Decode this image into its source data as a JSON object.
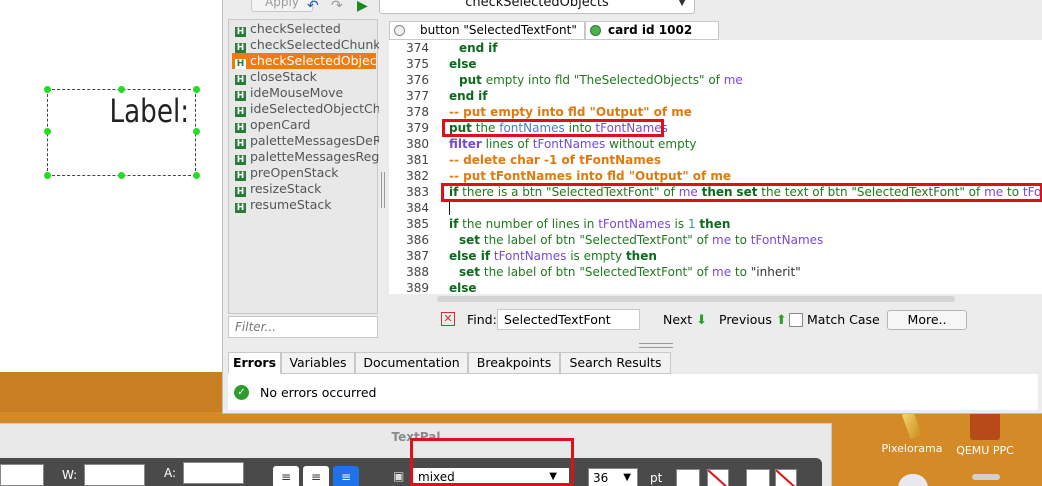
{
  "card": {
    "label_text": "Label:"
  },
  "editor": {
    "toolbar": {
      "apply_label": "Apply",
      "current_handler": "checkSelectedObjects"
    },
    "handlers": [
      "checkSelected",
      "checkSelectedChunk",
      "checkSelectedObjects",
      "closeStack",
      "ideMouseMove",
      "ideSelectedObjectChar",
      "openCard",
      "paletteMessagesDeRe",
      "paletteMessagesRegist",
      "preOpenStack",
      "resizeStack",
      "resumeStack"
    ],
    "selected_handler_index": 2,
    "filter_placeholder": "Filter...",
    "object_tabs": [
      "button \"SelectedTextFont\"",
      "card id 1002"
    ],
    "code_lines": [
      {
        "n": "374"
      },
      {
        "n": "375"
      },
      {
        "n": "376"
      },
      {
        "n": "377"
      },
      {
        "n": "378"
      },
      {
        "n": "379"
      },
      {
        "n": "380"
      },
      {
        "n": "381"
      },
      {
        "n": "382"
      },
      {
        "n": "383"
      },
      {
        "n": "384"
      },
      {
        "n": "385"
      },
      {
        "n": "386"
      },
      {
        "n": "387"
      },
      {
        "n": "388"
      },
      {
        "n": "389"
      }
    ],
    "code": {
      "l374_end": "end",
      "l374_if": "if",
      "l375": "else",
      "l376_put": "put",
      "l376_a": "empty into fld \"TheSelectedObjects\" of",
      "l376_me": "me",
      "l377_end": "end",
      "l377_if": "if",
      "l378": "-- put empty into fld \"Output\" of me",
      "l379_put": "put",
      "l379_the": "the",
      "l379_fn": "fontNames",
      "l379_into": "into",
      "l379_var": "tFontNames",
      "l380_filter": "filter",
      "l380_a": "lines of",
      "l380_var": "tFontNames",
      "l380_b": "without empty",
      "l381": "-- delete char -1 of tFontNames",
      "l382": "-- put tFontNames into fld \"Output\" of me",
      "l383_if": "if",
      "l383_a": "there is a btn \"SelectedTextFont\" of",
      "l383_me": "me",
      "l383_then": "then",
      "l383_set": "set",
      "l383_b": "the text of btn \"SelectedTextFont\" of",
      "l383_me2": "me",
      "l383_to": "to",
      "l383_var": "tFontNames",
      "l385_if": "if",
      "l385_a": "the number of lines in",
      "l385_var": "tFontNames",
      "l385_is": "is",
      "l385_one": "1",
      "l385_then": "then",
      "l386_set": "set",
      "l386_a": "the label of btn \"SelectedTextFont\" of",
      "l386_me": "me",
      "l386_to": "to",
      "l386_var": "tFontNames",
      "l387_else": "else if",
      "l387_var": "tFontNames",
      "l387_a": "is empty",
      "l387_then": "then",
      "l388_set": "set",
      "l388_a": "the label of btn \"SelectedTextFont\" of",
      "l388_me": "me",
      "l388_to": "to",
      "l388_str": "\"inherit\"",
      "l389": "else"
    },
    "find": {
      "label": "Find:",
      "value": "SelectedTextFont",
      "next_label": "Next",
      "previous_label": "Previous",
      "match_case_label": "Match Case",
      "more_label": "More.."
    },
    "bottom_tabs": [
      "Errors",
      "Variables",
      "Documentation",
      "Breakpoints",
      "Search Results"
    ],
    "status_text": "No errors occurred"
  },
  "textpal": {
    "title": "TextPal",
    "w_label": "W:",
    "a_label": "A:",
    "font_value": "mixed",
    "size_value": "36",
    "size_unit": "pt"
  },
  "desktop_icons": [
    "Pixelorama",
    "QEMU PPC"
  ],
  "colors": {
    "accent": "#f07b11",
    "highlight": "#e0101a",
    "keyword": "#0b6b1b",
    "variable": "#7a48d8",
    "comment": "#e07a10"
  }
}
